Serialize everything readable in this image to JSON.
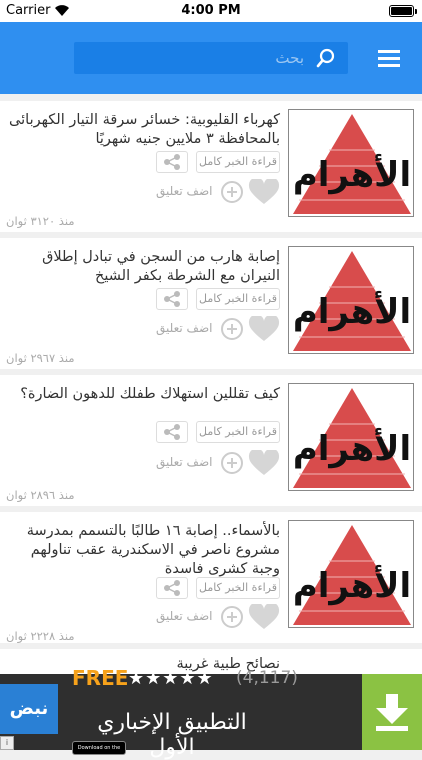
{
  "status_bar": {
    "carrier": "Carrier",
    "time": "4:00 PM"
  },
  "header": {
    "search_placeholder": "بحث"
  },
  "actions": {
    "read_full": "قراءة الخبر كامل",
    "add_comment": "اضف تعليق"
  },
  "articles": [
    {
      "title": "كهرباء القليوبية: خسائر سرقة التيار الكهربائى بالمحافظة ٣ ملايين جنيه شهريًا",
      "time": "منذ ٣١٢٠ ثوان"
    },
    {
      "title": "إصابة هارب من السجن في تبادل إطلاق النيران مع الشرطة بكفر الشيخ",
      "time": "منذ ٢٩٦٧ ثوان"
    },
    {
      "title": "كيف تقللين استهلاك طفلك للدهون الضارة؟",
      "time": "منذ ٢٨٩٦ ثوان"
    },
    {
      "title": "بالأسماء.. إصابة ١٦ طالبًا بالتسمم بمدرسة مشروع ناصر في الاسكندرية عقب تناولهم وجبة كشرى فاسدة",
      "time": "منذ ٢٢٢٨ ثوان"
    },
    {
      "title": "نصائح طبية غريبة",
      "time": ""
    }
  ],
  "ad": {
    "logo": "نبض",
    "free_label": "FREE",
    "stars": "★★★★★",
    "rating_count": "(4,117)",
    "title": "التطبيق الإخباري الأول",
    "store_label": "Download on the"
  },
  "colors": {
    "header": "#2f8ff0",
    "ad_button": "#8bc243",
    "ad_free": "#f7a21b"
  }
}
